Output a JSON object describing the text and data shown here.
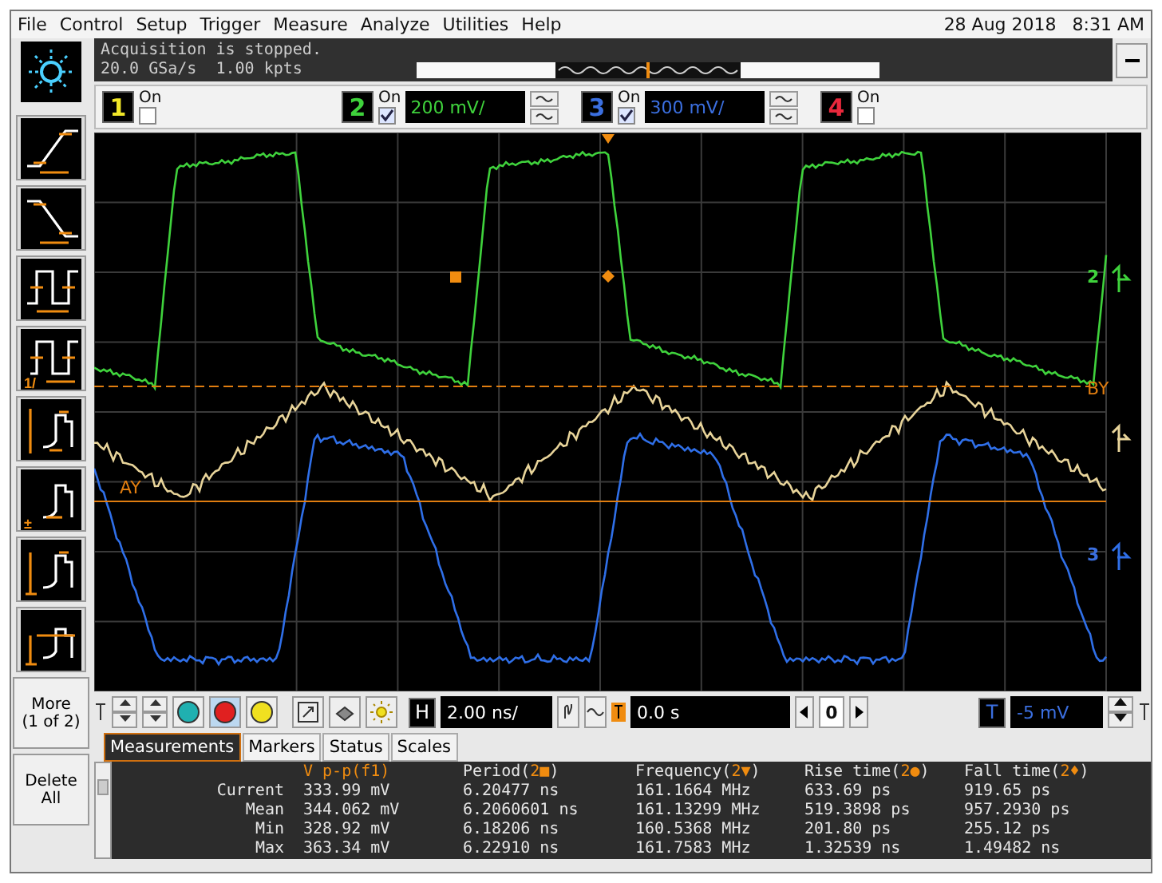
{
  "menu": [
    "File",
    "Control",
    "Setup",
    "Trigger",
    "Measure",
    "Analyze",
    "Utilities",
    "Help"
  ],
  "date": "28 Aug 2018",
  "time": "8:31 AM",
  "acquisition": {
    "status": "Acquisition is stopped.",
    "sample_rate": "20.0 GSa/s",
    "memory": "1.00 kpts"
  },
  "channels": [
    {
      "number": "1",
      "color": "#f0e628",
      "on_label": "On",
      "checked": false
    },
    {
      "number": "2",
      "color": "#3fd23c",
      "on_label": "On",
      "checked": true,
      "scale": "200 mV/"
    },
    {
      "number": "3",
      "color": "#3b6fe0",
      "on_label": "On",
      "checked": true,
      "scale": "300 mV/"
    },
    {
      "number": "4",
      "color": "#e8283c",
      "on_label": "On",
      "checked": false
    }
  ],
  "measurement_tools": [
    {
      "kind": "rise"
    },
    {
      "kind": "fall"
    },
    {
      "kind": "period"
    },
    {
      "kind": "frequency",
      "label": "1/"
    },
    {
      "kind": "vpp"
    },
    {
      "kind": "vbase",
      "label": "±"
    },
    {
      "kind": "vamp"
    },
    {
      "kind": "vtop"
    }
  ],
  "side_buttons": [
    {
      "label": "More",
      "sub": "(1 of 2)"
    },
    {
      "label": "Delete All"
    }
  ],
  "trace_labels": [
    {
      "text": "2",
      "color": "#3fd23c"
    },
    {
      "text": "3",
      "color": "#3b6fe0"
    }
  ],
  "markers": [
    {
      "text": "BY",
      "kind": "dashed"
    },
    {
      "text": "AY",
      "kind": "solid"
    }
  ],
  "horizontal": {
    "label": "H",
    "scale": "2.00 ns/",
    "delay": "0.0 s",
    "step": "0"
  },
  "trigger": {
    "label": "T",
    "level": "-5 mV"
  },
  "tabs": [
    {
      "label": "Measurements",
      "selected": true
    },
    {
      "label": "Markers",
      "selected": false
    },
    {
      "label": "Status",
      "selected": false
    },
    {
      "label": "Scales",
      "selected": false
    }
  ],
  "table": {
    "columns": [
      {
        "prefix": "V p-p(f1)",
        "highlighted": true
      },
      {
        "prefix": "Period(",
        "source": "2■",
        "suffix": ")",
        "highlighted": false
      },
      {
        "prefix": "Frequency(",
        "source": "2▼",
        "suffix": ")",
        "highlighted": false
      },
      {
        "prefix": "Rise time(",
        "source": "2●",
        "suffix": ")",
        "highlighted": false
      },
      {
        "prefix": "Fall time(",
        "source": "2♦",
        "suffix": ")",
        "highlighted": false
      }
    ],
    "rows": [
      {
        "label": "Current",
        "cells": [
          "333.99 mV",
          "6.20477 ns",
          "161.1664 MHz",
          "633.69 ps",
          "919.65 ps"
        ]
      },
      {
        "label": "Mean",
        "cells": [
          "344.062 mV",
          "6.2060601 ns",
          "161.13299 MHz",
          "519.3898 ps",
          "957.2930 ps"
        ]
      },
      {
        "label": "Min",
        "cells": [
          "328.92 mV",
          "6.18206 ns",
          "160.5368 MHz",
          "201.80 ps",
          "255.12 ps"
        ]
      },
      {
        "label": "Max",
        "cells": [
          "363.34 mV",
          "6.22910 ns",
          "161.7583 MHz",
          "1.32539 ns",
          "1.49482 ns"
        ]
      }
    ]
  }
}
